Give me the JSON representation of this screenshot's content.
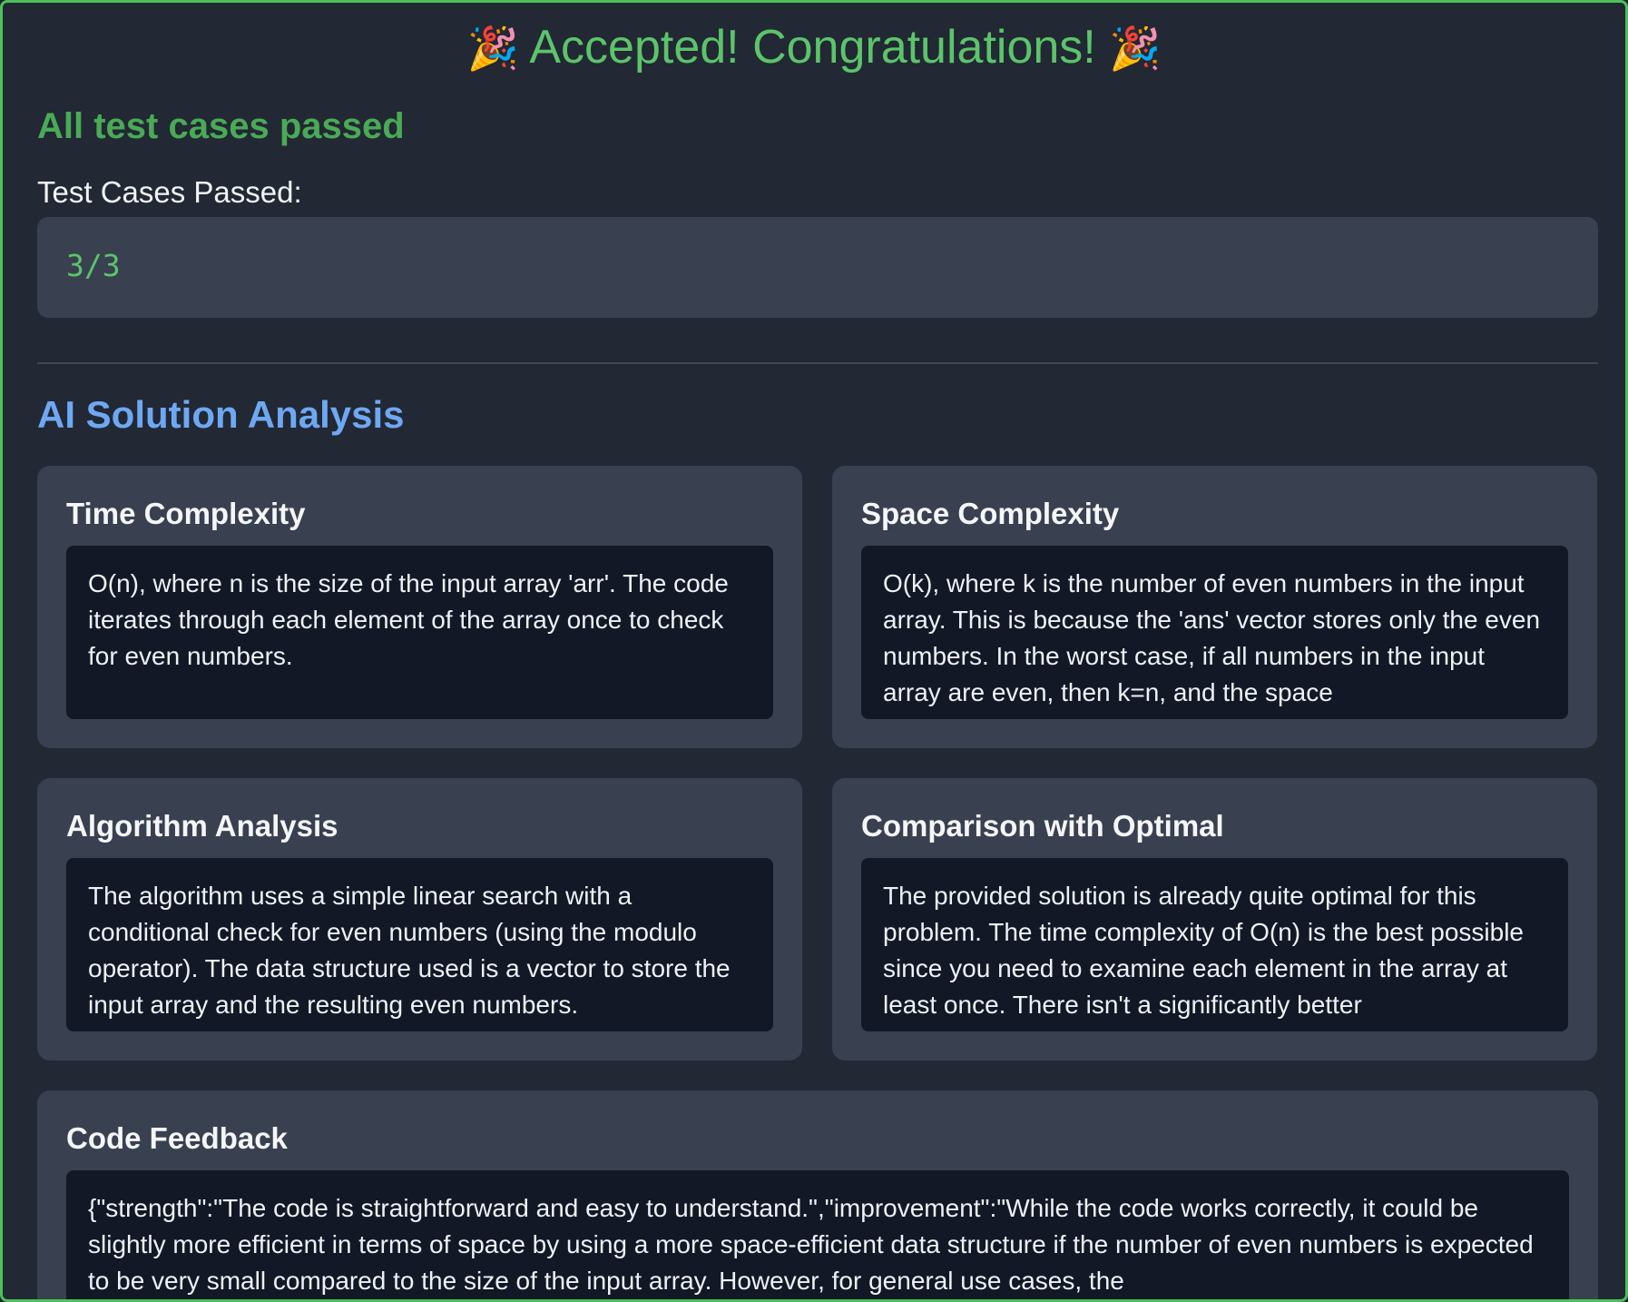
{
  "banner": {
    "party_icon_left": "🎉",
    "text": "Accepted! Congratulations!",
    "party_icon_right": "🎉"
  },
  "result": {
    "status": "All test cases passed",
    "test_cases_label": "Test Cases Passed:",
    "test_cases_value": "3/3"
  },
  "analysis": {
    "title": "AI Solution Analysis",
    "time_complexity": {
      "title": "Time Complexity",
      "text": "O(n), where n is the size of the input array 'arr'. The code iterates through each element of the array once to check for even numbers."
    },
    "space_complexity": {
      "title": "Space Complexity",
      "text": "O(k), where k is the number of even numbers in the input array. This is because the 'ans' vector stores only the even numbers. In the worst case, if all numbers in the input array are even, then k=n, and the space"
    },
    "algorithm_analysis": {
      "title": "Algorithm Analysis",
      "text": "The algorithm uses a simple linear search with a conditional check for even numbers (using the modulo operator). The data structure used is a vector to store the input array and the resulting even numbers."
    },
    "comparison_with_optimal": {
      "title": "Comparison with Optimal",
      "text": "The provided solution is already quite optimal for this problem. The time complexity of O(n) is the best possible since you need to examine each element in the array at least once. There isn't a significantly better"
    },
    "code_feedback": {
      "title": "Code Feedback",
      "text": "{\"strength\":\"The code is straightforward and easy to understand.\",\"improvement\":\"While the code works correctly, it could be slightly more efficient in terms of space by using a more space-efficient data structure if the number of even numbers is expected to be very small compared to the size of the input array. However, for general use cases, the"
    }
  },
  "colors": {
    "accent_green": "#5cc46a",
    "status_green": "#4aaa56",
    "accent_blue": "#6ea8f2",
    "border_green": "#4cc15a"
  }
}
